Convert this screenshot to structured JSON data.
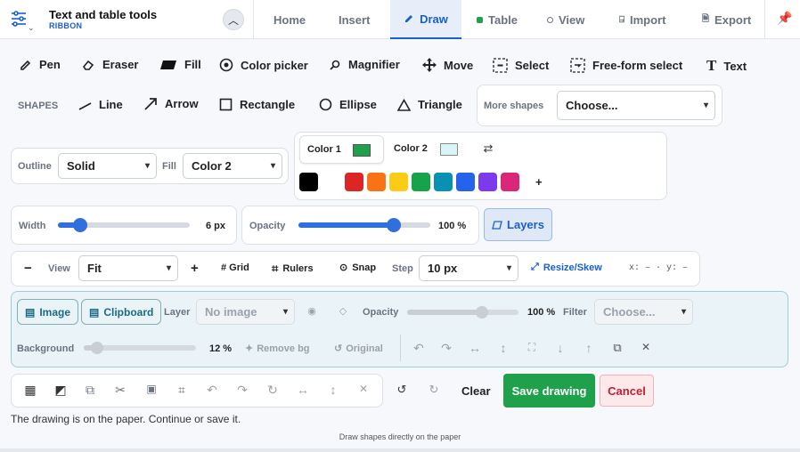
{
  "header": {
    "title": "Text and table tools",
    "subtitle": "RIBBON",
    "tabs": [
      {
        "label": "Home"
      },
      {
        "label": "Insert"
      },
      {
        "label": "Draw"
      },
      {
        "label": "Table"
      },
      {
        "label": "View"
      },
      {
        "label": "Import"
      },
      {
        "label": "Export"
      }
    ]
  },
  "tools": {
    "pen": "Pen",
    "eraser": "Eraser",
    "fill": "Fill",
    "color_picker": "Color picker",
    "magnifier": "Magnifier",
    "move": "Move",
    "select": "Select",
    "freeform_select": "Free-form select",
    "text": "Text"
  },
  "shapes": {
    "label": "SHAPES",
    "line": "Line",
    "arrow": "Arrow",
    "rectangle": "Rectangle",
    "ellipse": "Ellipse",
    "triangle": "Triangle",
    "more_label": "More shapes",
    "more_value": "Choose..."
  },
  "style": {
    "outline_label": "Outline",
    "outline_value": "Solid",
    "fill_label": "Fill",
    "fill_value": "Color 2"
  },
  "colors": {
    "color1_label": "Color 1",
    "color1": "#1fa04b",
    "color2_label": "Color 2",
    "color2": "#d9f5f7",
    "palette": [
      "#000000",
      "#dc2626",
      "#f97316",
      "#facc15",
      "#16a34a",
      "#0891b2",
      "#2563eb",
      "#7c3aed",
      "#db2777"
    ],
    "add_symbol": "+"
  },
  "stroke": {
    "width_label": "Width",
    "width_value": "6 px",
    "width_fraction": 0.17,
    "opacity_label": "Opacity",
    "opacity_value": "100 %",
    "opacity_fraction": 0.72,
    "layers_label": "Layers"
  },
  "view": {
    "view_label": "View",
    "zoom_value": "Fit",
    "grid": "# Grid",
    "rulers": "Rulers",
    "snap": "Snap",
    "step_label": "Step",
    "step_value": "10 px",
    "resize": "Resize/Skew",
    "coords": "x: – · y: –"
  },
  "image": {
    "image_btn": "Image",
    "clipboard_btn": "Clipboard",
    "layer_label": "Layer",
    "layer_value": "No image",
    "opacity_label": "Opacity",
    "opacity_value": "100 %",
    "opacity_fraction": 0.67,
    "filter_label": "Filter",
    "filter_value": "Choose...",
    "background_label": "Background",
    "background_value": "12 %",
    "background_fraction": 0.12,
    "remove_bg": "Remove bg",
    "original": "Original"
  },
  "actions": {
    "clear": "Clear",
    "save": "Save drawing",
    "cancel": "Cancel"
  },
  "status": {
    "message": "The drawing is on the paper. Continue or save it.",
    "hint": "Draw shapes directly on the paper"
  }
}
